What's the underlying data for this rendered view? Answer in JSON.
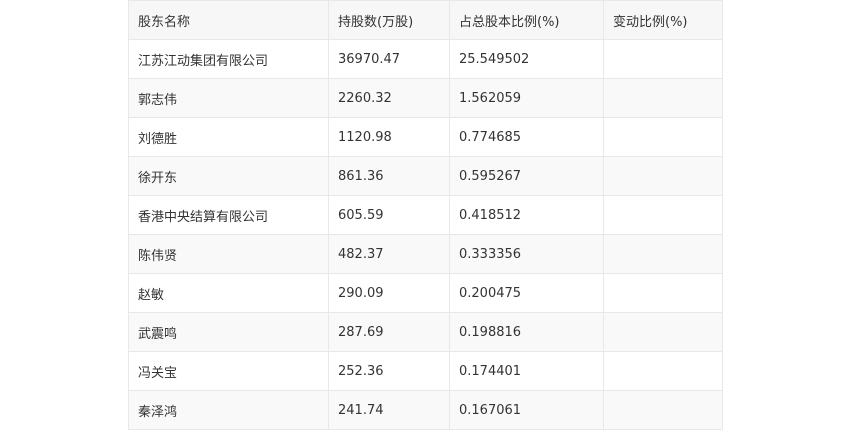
{
  "table": {
    "headers": [
      "股东名称",
      "持股数(万股)",
      "占总股本比例(%)",
      "变动比例(%)"
    ],
    "rows": [
      [
        "江苏江动集团有限公司",
        "36970.47",
        "25.549502",
        ""
      ],
      [
        "郭志伟",
        "2260.32",
        "1.562059",
        ""
      ],
      [
        "刘德胜",
        "1120.98",
        "0.774685",
        ""
      ],
      [
        "徐开东",
        "861.36",
        "0.595267",
        ""
      ],
      [
        "香港中央结算有限公司",
        "605.59",
        "0.418512",
        ""
      ],
      [
        "陈伟贤",
        "482.37",
        "0.333356",
        ""
      ],
      [
        "赵敏",
        "290.09",
        "0.200475",
        ""
      ],
      [
        "武震鸣",
        "287.69",
        "0.198816",
        ""
      ],
      [
        "冯关宝",
        "252.36",
        "0.174401",
        ""
      ],
      [
        "秦泽鸿",
        "241.74",
        "0.167061",
        ""
      ]
    ]
  }
}
